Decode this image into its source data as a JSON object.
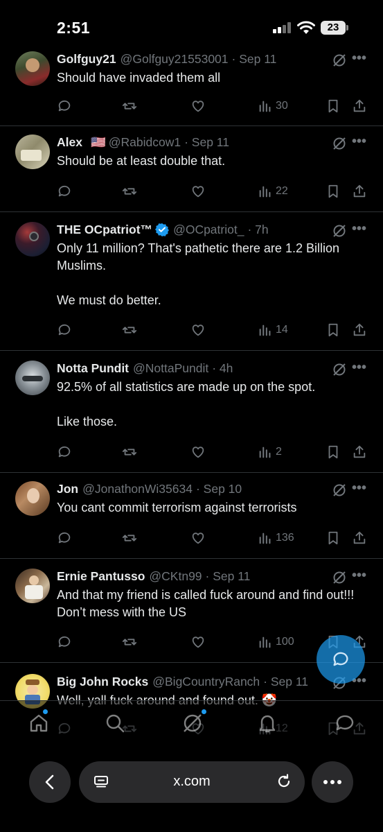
{
  "status_bar": {
    "time": "2:51",
    "battery": "23"
  },
  "tweets": [
    {
      "name": "Golfguy21",
      "handle": "@Golfguy21553001",
      "time": "· Sep 11",
      "text": "Should have invaded them all",
      "views": "30"
    },
    {
      "name": "Alex",
      "handle": "@Rabidcow1",
      "time": "· Sep 11",
      "flag": "🇺🇸",
      "text": "Should be at least double that.",
      "views": "22"
    },
    {
      "name": "THE OCpatriot™",
      "handle": "@OCpatriot_",
      "time": "· 7h",
      "text": "Only 11 million? That's pathetic there are 1.2 Billion Muslims.\n\nWe must do better.",
      "views": "14"
    },
    {
      "name": "Notta Pundit",
      "handle": "@NottaPundit",
      "time": "· 4h",
      "text": "92.5% of all statistics are made up on the spot.\n\nLike those.",
      "views": "2"
    },
    {
      "name": "Jon",
      "handle": "@JonathonWi35634",
      "time": "· Sep 10",
      "text": "You cant commit terrorism against terrorists",
      "views": "136"
    },
    {
      "name": "Ernie Pantusso",
      "handle": "@CKtn99",
      "time": "· Sep 11",
      "text": "And that my friend is called fuck around and find out!!! Don’t mess with the US",
      "views": "100"
    },
    {
      "name": "Big John Rocks",
      "handle": "@BigCountryRanch",
      "time": "· Sep 11",
      "text": "Well, yall fuck around and found out. 🤡",
      "views": "12"
    }
  ],
  "more_label": "•••",
  "browser": {
    "url": "x.com"
  },
  "colors": {
    "accent": "#1d9bf0",
    "muted": "#71767b",
    "divider": "#2f3336"
  },
  "icons": [
    "reply-icon",
    "retweet-icon",
    "like-icon",
    "views-icon",
    "bookmark-icon",
    "share-icon",
    "grok-icon",
    "home-icon",
    "search-icon",
    "notifications-icon",
    "messages-icon"
  ]
}
